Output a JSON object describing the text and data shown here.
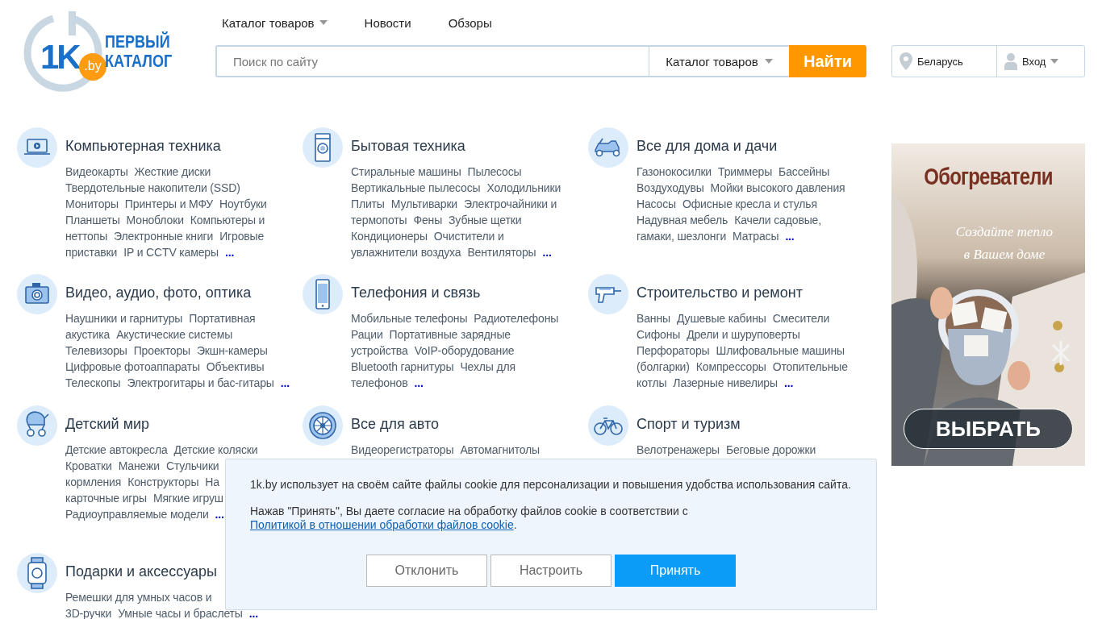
{
  "logo": {
    "mark": "1K",
    "domain": ".by",
    "line_1": "ПЕРВЫЙ",
    "line_2": "КАТАЛОГ"
  },
  "nav": [
    {
      "label": "Каталог товаров",
      "dropdown": true
    },
    {
      "label": "Новости",
      "dropdown": false
    },
    {
      "label": "Обзоры",
      "dropdown": false
    }
  ],
  "search": {
    "placeholder": "Поиск по сайту",
    "scope": "Каталог товаров",
    "button": "Найти"
  },
  "location": {
    "region": "Беларусь",
    "login": "Вход"
  },
  "categories": [
    {
      "title": "Компьютерная техника",
      "link_lines": [
        [
          "Видеокарты",
          "Жесткие диски"
        ],
        [
          "Твердотельные накопители (SSD)"
        ],
        [
          "Мониторы",
          "Принтеры и МФУ",
          "Ноутбуки"
        ],
        [
          "Планшеты",
          "Моноблоки",
          "Компьютеры и"
        ],
        [
          "неттопы",
          "Электронные книги",
          "Игровые"
        ],
        [
          "приставки",
          "IP и CCTV камеры"
        ]
      ],
      "more": "..."
    },
    {
      "title": "Бытовая техника",
      "link_lines": [
        [
          "Стиральные машины",
          "Пылесосы"
        ],
        [
          "Вертикальные пылесосы",
          "Холодильники"
        ],
        [
          "Плиты",
          "Мультиварки",
          "Электрочайники и"
        ],
        [
          "термопоты",
          "Фены",
          "Зубные щетки"
        ],
        [
          "Кондиционеры",
          "Очистители и"
        ],
        [
          "увлажнители воздуха",
          "Вентиляторы"
        ]
      ],
      "more": "..."
    },
    {
      "title": "Все для дома и дачи",
      "link_lines": [
        [
          "Газонокосилки",
          "Триммеры",
          "Бассейны"
        ],
        [
          "Воздуходувы",
          "Мойки высокого давления"
        ],
        [
          "Насосы",
          "Офисные кресла и стулья"
        ],
        [
          "Надувная мебель",
          "Качели садовые,"
        ],
        [
          "гамаки, шезлонги",
          "Матрасы"
        ]
      ],
      "more": "..."
    },
    {
      "title": "Видео, аудио, фото, оптика",
      "link_lines": [
        [
          "Наушники и гарнитуры",
          "Портативная"
        ],
        [
          "акустика",
          "Акустические системы"
        ],
        [
          "Телевизоры",
          "Проекторы",
          "Экшн-камеры"
        ],
        [
          "Цифровые фотоаппараты",
          "Объективы"
        ],
        [
          "Телескопы",
          "Электрогитары и бас-гитары"
        ]
      ],
      "more": "..."
    },
    {
      "title": "Телефония и связь",
      "link_lines": [
        [
          "Мобильные телефоны",
          "Радиотелефоны"
        ],
        [
          "Рации",
          "Портативные зарядные"
        ],
        [
          "устройства",
          "VoIP-оборудование"
        ],
        [
          "Bluetooth гарнитуры",
          "Чехлы для"
        ],
        [
          "телефонов"
        ]
      ],
      "more": "..."
    },
    {
      "title": "Строительство и ремонт",
      "link_lines": [
        [
          "Ванны",
          "Душевые кабины",
          "Смесители"
        ],
        [
          "Сифоны",
          "Дрели и шуруповерты"
        ],
        [
          "Перфораторы",
          "Шлифовальные машины"
        ],
        [
          "(болгарки)",
          "Компрессоры",
          "Отопительные"
        ],
        [
          "котлы",
          "Лазерные нивелиры"
        ]
      ],
      "more": "..."
    },
    {
      "title": "Детский мир",
      "link_lines": [
        [
          "Детские автокресла",
          "Детские коляски"
        ],
        [
          "Кроватки",
          "Манежи",
          "Стульчики"
        ],
        [
          "кормления",
          "Конструкторы",
          "На"
        ],
        [
          "карточные игры",
          "Мягкие игруш"
        ],
        [
          "Радиоуправляемые модели"
        ]
      ],
      "more": "..."
    },
    {
      "title": "Все для авто",
      "link_lines": [
        [
          "Видеорегистраторы",
          "Автомагнитолы"
        ]
      ]
    },
    {
      "title": "Спорт и туризм",
      "link_lines": [
        [
          "Велотренажеры",
          "Беговые дорожки"
        ]
      ]
    },
    {
      "title": "Подарки и аксессуары",
      "link_lines": [
        [
          "Ремешки для умных часов и"
        ],
        [
          "3D-ручки",
          "Умные часы и браслеты"
        ]
      ],
      "more": "..."
    }
  ],
  "ad": {
    "kind": "picture",
    "headline": "Обогреватели",
    "tagline": "Создайте тепло в Вашем доме",
    "button": "ВЫБРАТЬ"
  },
  "cookie_notice": {
    "text": "1k.by использует на своём сайте файлы cookie для персонализации и повышения удобства использования сайта.",
    "consent": "Нажав \"Принять\", Вы даете согласие на обработку файлов cookie в соответствии с",
    "policy_link": "Политикой в отношении обработки файлов cookie",
    "end": ".",
    "buttons": [
      {
        "label": "Отклонить",
        "kind": "secondary"
      },
      {
        "label": "Настроить",
        "kind": "secondary"
      },
      {
        "label": "Принять",
        "kind": "primary"
      }
    ]
  }
}
